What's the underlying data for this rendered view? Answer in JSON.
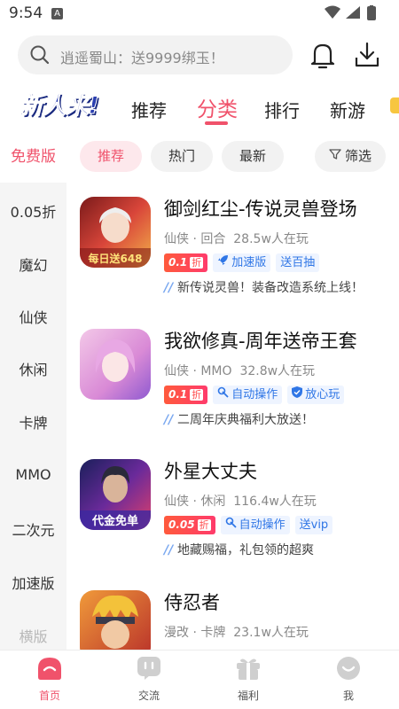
{
  "status_bar": {
    "time": "9:54",
    "notice_icon": "A"
  },
  "search": {
    "placeholder": "逍遥蜀山：送9999绑玉！"
  },
  "logo_text": "新人来!",
  "top_tabs": [
    {
      "label": "推荐",
      "active": false
    },
    {
      "label": "分类",
      "active": true
    },
    {
      "label": "排行",
      "active": false
    },
    {
      "label": "新游",
      "active": false
    }
  ],
  "categories": [
    "免费版",
    "0.05折",
    "魔幻",
    "仙侠",
    "休闲",
    "卡牌",
    "MMO",
    "二次元",
    "加速版",
    "横版"
  ],
  "filters": {
    "recommend": "推荐",
    "hot": "热门",
    "latest": "最新",
    "filter": "筛选"
  },
  "games": [
    {
      "title": "御剑红尘-传说灵兽登场",
      "genre": "仙侠 · 回合",
      "players": "28.5w人在玩",
      "discount": "0.1",
      "discount_unit": "折",
      "tags": [
        "加速版",
        "送百抽"
      ],
      "note": "新传说灵兽！装备改造系统上线！",
      "icon_text": "每日送648",
      "icon_color": "#c63a2a"
    },
    {
      "title": "我欲修真-周年送帝王套",
      "genre": "仙侠 · MMO",
      "players": "32.8w人在玩",
      "discount": "0.1",
      "discount_unit": "折",
      "tags": [
        "自动操作",
        "放心玩"
      ],
      "note": "二周年庆典福利大放送！",
      "icon_text": "",
      "icon_color": "#d98ad6"
    },
    {
      "title": "外星大丈夫",
      "genre": "仙侠 · 休闲",
      "players": "116.4w人在玩",
      "discount": "0.05",
      "discount_unit": "折",
      "tags": [
        "自动操作",
        "送vip"
      ],
      "note": "地藏赐福，礼包领的超爽",
      "icon_text": "代金免单",
      "icon_color": "#3d2a7a"
    },
    {
      "title": "侍忍者",
      "genre": "漫改 · 卡牌",
      "players": "23.1w人在玩",
      "icon_color": "#c44a2a"
    }
  ],
  "bottom_nav": [
    {
      "label": "首页",
      "icon": "home-icon",
      "active": true
    },
    {
      "label": "交流",
      "icon": "chat-icon",
      "active": false
    },
    {
      "label": "福利",
      "icon": "gift-icon",
      "active": false
    },
    {
      "label": "我",
      "icon": "profile-icon",
      "active": false
    }
  ],
  "colors": {
    "accent": "#f0526b",
    "tag_blue": "#2f76e6",
    "discount_red": "#ff4a4a"
  }
}
